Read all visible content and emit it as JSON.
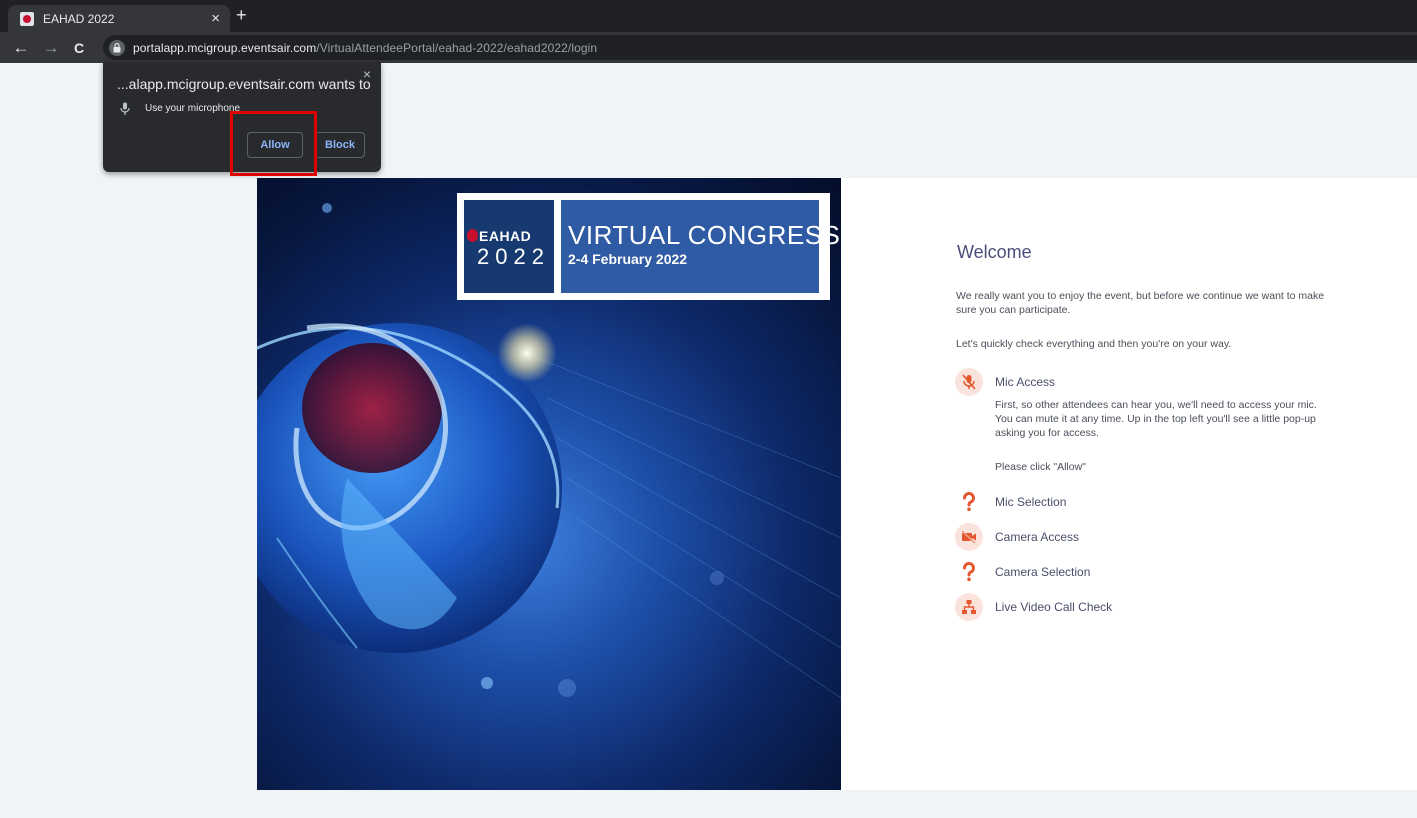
{
  "browser": {
    "tab_title": "EAHAD 2022",
    "tab_close": "×",
    "new_tab": "+",
    "back": "←",
    "forward": "→",
    "reload": "C",
    "url_host": "portalapp.mcigroup.eventsair.com",
    "url_path": "/VirtualAttendeePortal/eahad-2022/eahad2022/login"
  },
  "permission_popup": {
    "title": "...alapp.mcigroup.eventsair.com wants to",
    "close": "×",
    "request": "Use your microphone",
    "allow": "Allow",
    "block": "Block"
  },
  "hero": {
    "brand": "EAHAD",
    "year": "2022",
    "headline": "VIRTUAL CONGRESS",
    "dates": "2-4 February 2022"
  },
  "welcome": {
    "title": "Welcome",
    "intro": "We really want you to enjoy the event, but before we continue we want to make sure you can participate.",
    "intro2": "Let's quickly check everything and then you're on your way.",
    "steps": [
      {
        "label": "Mic Access",
        "icon": "mic-off-icon"
      },
      {
        "label": "Mic Selection",
        "icon": "question-icon"
      },
      {
        "label": "Camera Access",
        "icon": "camera-off-icon"
      },
      {
        "label": "Camera Selection",
        "icon": "question-icon"
      },
      {
        "label": "Live Video Call Check",
        "icon": "network-icon"
      }
    ],
    "mic_detail": "First, so other attendees can hear you, we'll need to access your mic. You can mute it at any time. Up in the top left you'll see a little pop-up asking you for access.",
    "mic_prompt": "Please click \"Allow\""
  },
  "colors": {
    "accent": "#e4572e",
    "accent_bg": "#fbe3dd",
    "highlight": "#e10000",
    "title_text": "#4a4f7a"
  }
}
